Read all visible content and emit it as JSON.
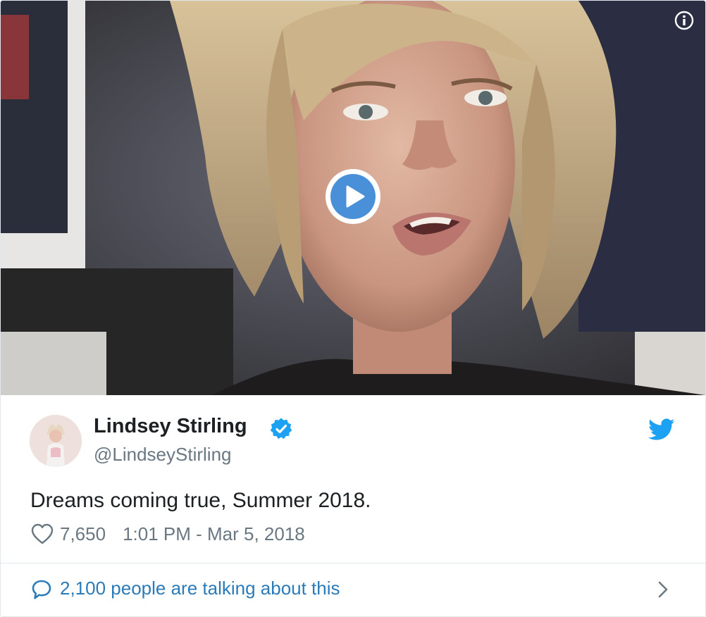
{
  "video": {
    "thumbnail_description": "video-thumbnail",
    "play_button": "play-icon",
    "info_button": "info-icon"
  },
  "tweet": {
    "author_name": "Lindsey Stirling",
    "handle": "@LindseyStirling",
    "verified": true,
    "text": "Dreams coming true, Summer 2018.",
    "likes": "7,650",
    "timestamp": "1:01 PM - Mar 5, 2018"
  },
  "footer": {
    "label": "2,100 people are talking about this"
  },
  "colors": {
    "twitter_blue": "#1da1f2",
    "link_blue": "#2b7bb9",
    "text_dark": "#1c2022",
    "text_muted": "#697882",
    "play_blue": "#4a90d9",
    "border": "#e1e8ed"
  }
}
